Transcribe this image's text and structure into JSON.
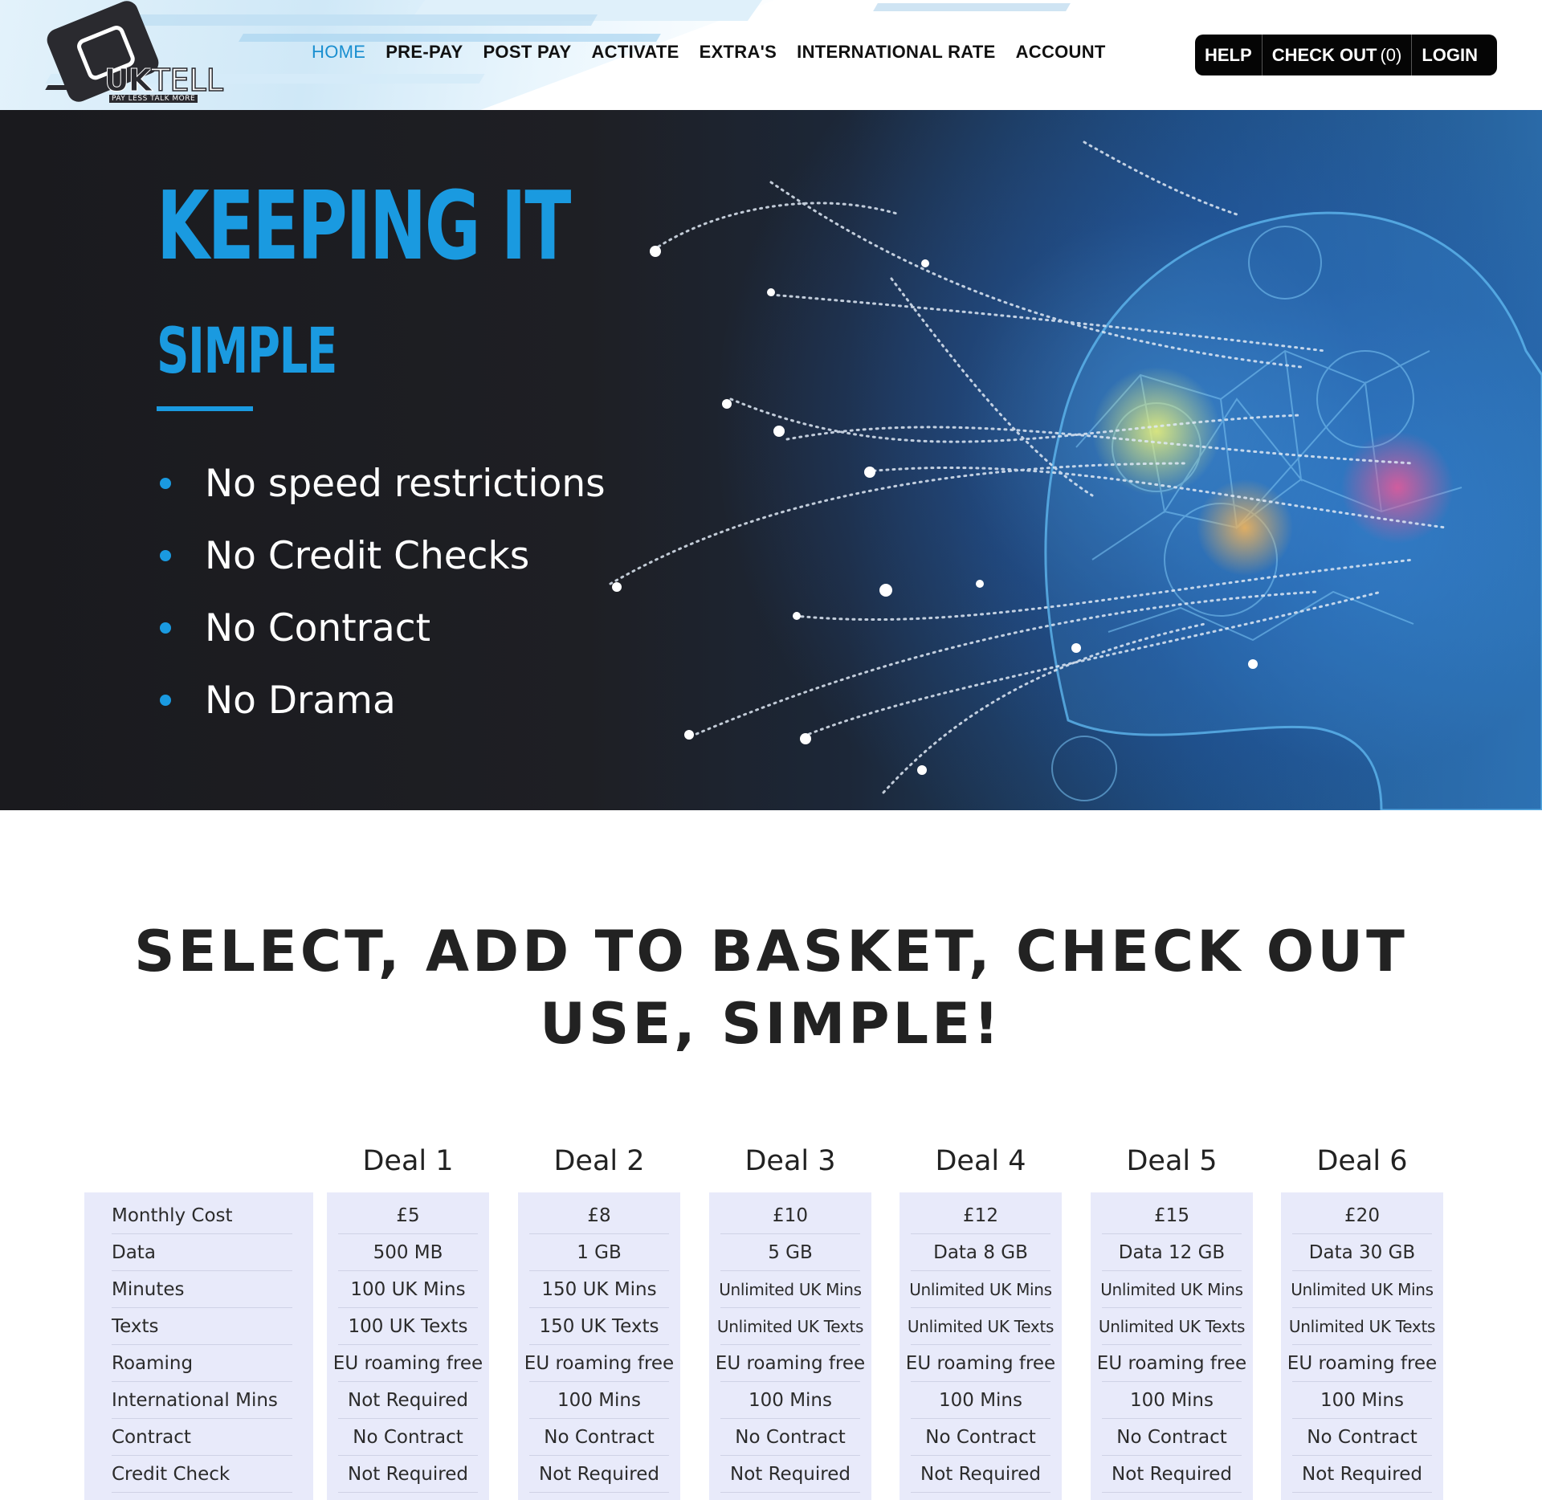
{
  "header": {
    "logo": {
      "brand_uk": "UK",
      "brand_tell": "TELL",
      "tagline": "PAY LESS TALK MORE"
    },
    "nav": [
      {
        "label": "HOME",
        "active": true
      },
      {
        "label": "PRE-PAY",
        "active": false
      },
      {
        "label": "POST PAY",
        "active": false
      },
      {
        "label": "ACTIVATE",
        "active": false
      },
      {
        "label": "EXTRA'S",
        "active": false
      },
      {
        "label": "INTERNATIONAL RATE",
        "active": false
      },
      {
        "label": "ACCOUNT",
        "active": false
      }
    ],
    "actions": {
      "help": "HELP",
      "checkout": "CHECK OUT",
      "checkout_count": "(0)",
      "login": "LOGIN"
    }
  },
  "hero": {
    "title": "KEEPING IT",
    "subtitle": "SIMPLE",
    "points": [
      "No speed restrictions",
      "No Credit Checks",
      "No Contract",
      "No Drama"
    ],
    "image_icon": "digital-head-network-illustration"
  },
  "headline": {
    "line1": "SELECT, ADD TO BASKET, CHECK OUT",
    "line2": "USE, SIMPLE!"
  },
  "pricing": {
    "row_labels": [
      "Monthly Cost",
      "Data",
      "Minutes",
      "Texts",
      "Roaming",
      "International Mins",
      "Contract",
      "Credit Check"
    ],
    "deals": [
      {
        "name": "Deal 1",
        "values": [
          "£5",
          "500 MB",
          "100 UK Mins",
          "100 UK Texts",
          "EU roaming free",
          "Not Required",
          "No Contract",
          "Not Required"
        ]
      },
      {
        "name": "Deal 2",
        "values": [
          "£8",
          "1 GB",
          "150 UK Mins",
          "150 UK Texts",
          "EU roaming free",
          "100 Mins",
          "No Contract",
          "Not Required"
        ]
      },
      {
        "name": "Deal 3",
        "values": [
          "£10",
          "5 GB",
          "Unlimited UK Mins",
          "Unlimited UK Texts",
          "EU roaming free",
          "100 Mins",
          "No Contract",
          "Not Required"
        ]
      },
      {
        "name": "Deal 4",
        "values": [
          "£12",
          "Data 8 GB",
          "Unlimited UK Mins",
          "Unlimited UK Texts",
          "EU roaming free",
          "100 Mins",
          "No Contract",
          "Not Required"
        ]
      },
      {
        "name": "Deal 5",
        "values": [
          "£15",
          "Data 12 GB",
          "Unlimited UK Mins",
          "Unlimited UK Texts",
          "EU roaming free",
          "100 Mins",
          "No Contract",
          "Not Required"
        ]
      },
      {
        "name": "Deal 6",
        "values": [
          "£20",
          "Data 30 GB",
          "Unlimited UK Mins",
          "Unlimited UK Texts",
          "EU roaming free",
          "100 Mins",
          "No Contract",
          "Not Required"
        ]
      }
    ]
  },
  "colors": {
    "accent": "#1a9ae0",
    "nav_active": "#1a8fd0",
    "hero_dark": "#1e1f24",
    "table_bg": "#e8eafa",
    "action_bar": "#050505"
  }
}
